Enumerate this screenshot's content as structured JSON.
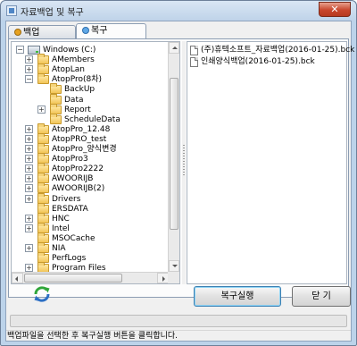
{
  "window": {
    "title": "자료백업 및 복구",
    "close_label": "✕"
  },
  "tabs": [
    {
      "label": "백업(Backup)",
      "active": false
    },
    {
      "label": "복구(Restore)",
      "active": true
    }
  ],
  "tree": {
    "root": "Windows (C:)",
    "items": [
      {
        "label": "AMembers",
        "expandable": true
      },
      {
        "label": "AtopLan",
        "expandable": true
      },
      {
        "label": "AtopPro(8차)",
        "expandable": true,
        "expanded": true
      },
      {
        "label": "BackUp",
        "expandable": false,
        "child": true
      },
      {
        "label": "Data",
        "expandable": false,
        "child": true
      },
      {
        "label": "Report",
        "expandable": true,
        "child": true
      },
      {
        "label": "ScheduleData",
        "expandable": false,
        "child": true
      },
      {
        "label": "AtopPro_12.48",
        "expandable": true
      },
      {
        "label": "AtopPRO_test",
        "expandable": true
      },
      {
        "label": "AtopPro_양식변경",
        "expandable": true
      },
      {
        "label": "AtopPro3",
        "expandable": true
      },
      {
        "label": "AtopPro2222",
        "expandable": true
      },
      {
        "label": "AWOORIJB",
        "expandable": true
      },
      {
        "label": "AWOORIJB(2)",
        "expandable": true
      },
      {
        "label": "Drivers",
        "expandable": true
      },
      {
        "label": "ERSDATA",
        "expandable": false
      },
      {
        "label": "HNC",
        "expandable": true
      },
      {
        "label": "Intel",
        "expandable": true
      },
      {
        "label": "MSOCache",
        "expandable": false
      },
      {
        "label": "NIA",
        "expandable": true
      },
      {
        "label": "PerfLogs",
        "expandable": false
      },
      {
        "label": "Program Files",
        "expandable": true
      }
    ]
  },
  "files": [
    "(주)휴텍소프트_자료백업(2016-01-25).bck",
    "인쇄양식백업(2016-01-25).bck"
  ],
  "buttons": {
    "restore": "복구실행",
    "close": "닫 기"
  },
  "status_text": "백업파일을 선택한 후 복구실행 버튼을 클릭합니다.",
  "colors": {
    "refresh_green": "#2fa63a",
    "refresh_blue": "#2c6fc4"
  },
  "icons": {
    "refresh": "refresh-icon",
    "folder": "folder-icon",
    "drive": "drive-icon",
    "file": "file-icon"
  }
}
